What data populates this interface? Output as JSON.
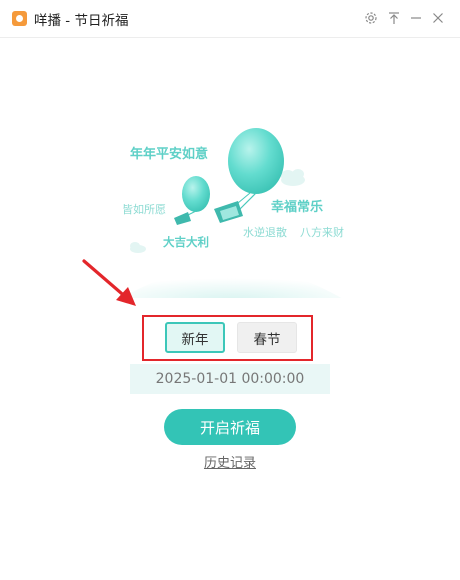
{
  "window": {
    "title": "咩播 - 节日祈福",
    "app_icon": "app-logo-icon",
    "controls": [
      "settings-icon",
      "pin-top-icon",
      "minimize-icon",
      "close-icon"
    ]
  },
  "illustration": {
    "blessings": [
      "年年平安如意",
      "皆如所愿",
      "大吉大利",
      "幸福常乐",
      "水逆退散",
      "八方来财"
    ],
    "balloon_color": "#5fd9cb"
  },
  "festival_tabs": [
    {
      "label": "新年",
      "selected": true
    },
    {
      "label": "春节",
      "selected": false
    }
  ],
  "datetime": "2025-01-01 00:00:00",
  "start_button": "开启祈福",
  "history_link": "历史记录",
  "colors": {
    "accent": "#33c4b6",
    "highlight_box": "#e3262b",
    "annotation_arrow": "#e3262b"
  }
}
